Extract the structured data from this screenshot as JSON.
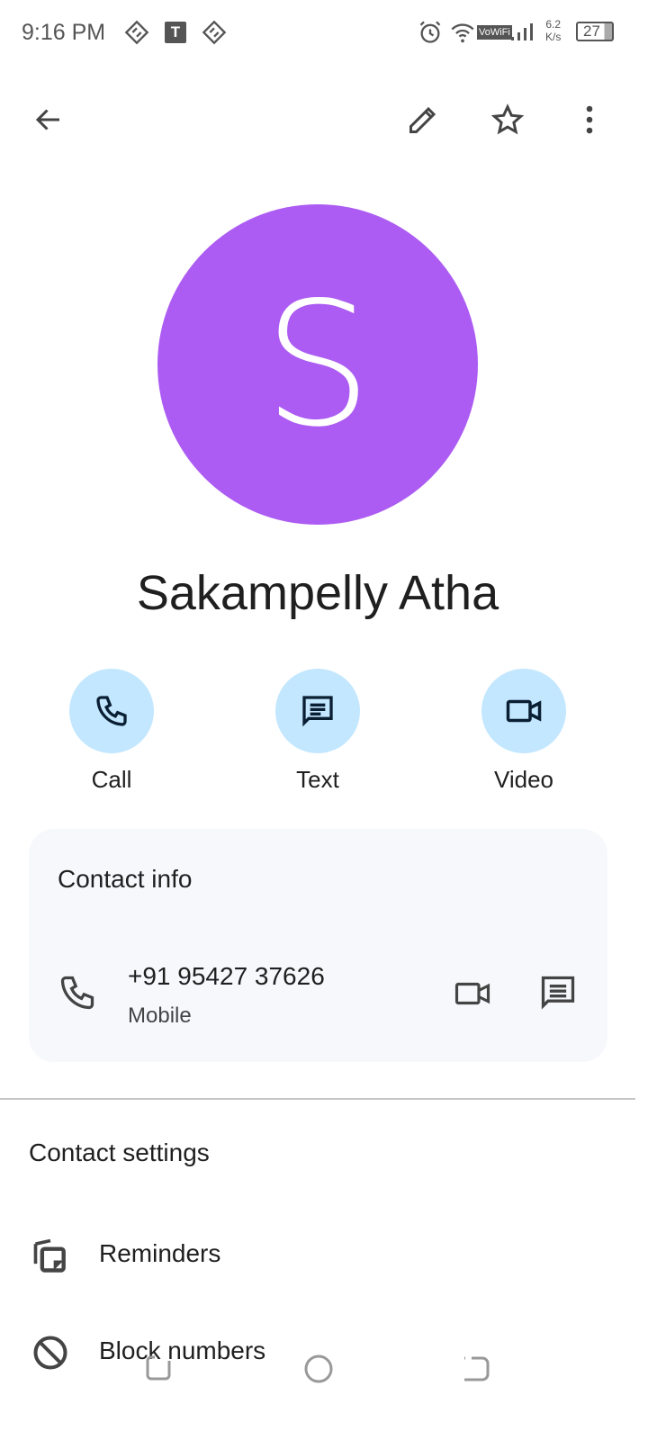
{
  "status_bar": {
    "time": "9:16 PM",
    "network_speed_value": "6.2",
    "network_speed_unit": "K/s",
    "vowifi": "VoWiFi",
    "battery": "27",
    "notification_letter": "T"
  },
  "contact": {
    "initial": "S",
    "name": "Sakampelly Atha",
    "avatar_color": "#ac5cf2"
  },
  "actions": [
    {
      "label": "Call",
      "icon": "phone-icon"
    },
    {
      "label": "Text",
      "icon": "message-icon"
    },
    {
      "label": "Video",
      "icon": "video-icon"
    }
  ],
  "contact_info": {
    "title": "Contact info",
    "phone": "+91 95427 37626",
    "phone_type": "Mobile"
  },
  "contact_settings": {
    "title": "Contact settings",
    "items": [
      {
        "label": "Reminders",
        "icon": "reminders-icon"
      },
      {
        "label": "Block numbers",
        "icon": "block-icon"
      }
    ]
  }
}
